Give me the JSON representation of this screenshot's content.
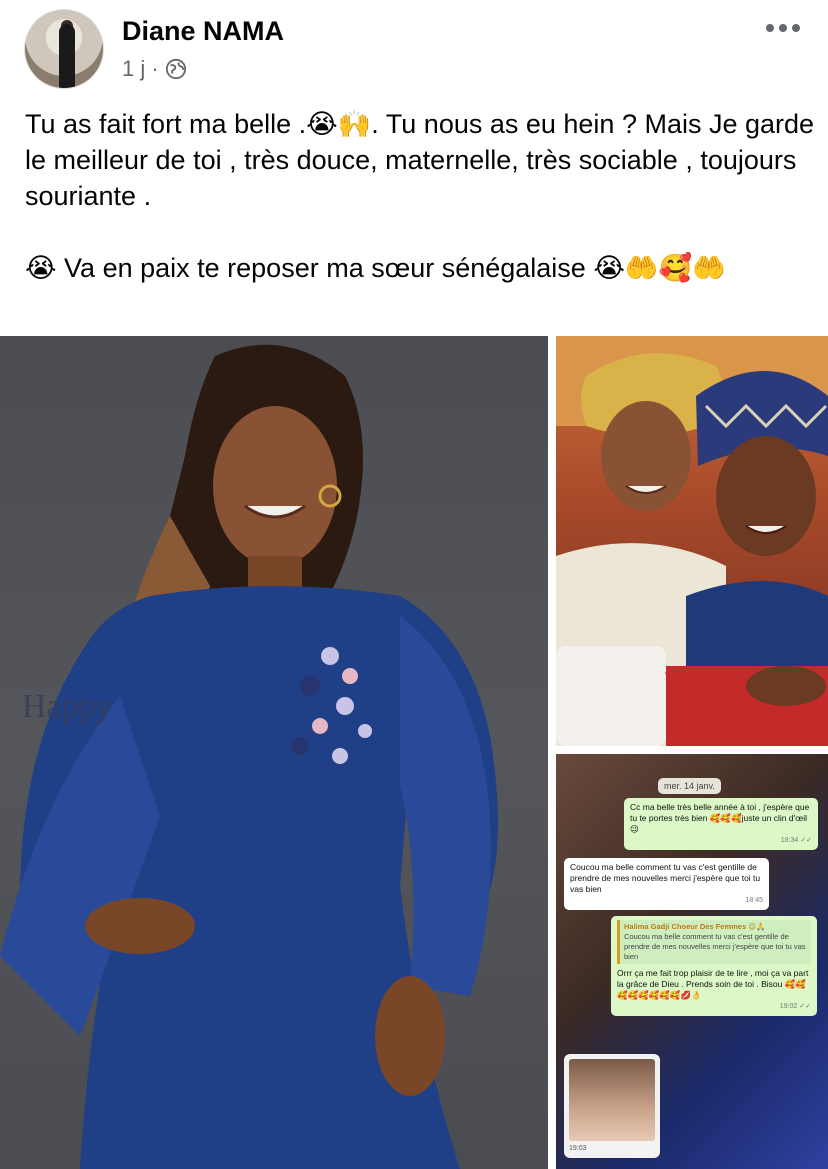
{
  "post": {
    "author": "Diane NAMA",
    "time": "1 j ·",
    "privacy_icon": "globe-icon",
    "text": "Tu as fait fort ma belle .😭🙌. Tu nous as eu hein ? Mais Je garde le meilleur de toi , très douce, maternelle, très sociable , toujours souriante .\n\n😭 Va en paix te reposer ma sœur sénégalaise 😭🤲🥰🤲"
  },
  "photos": {
    "main_watermark": "Happy",
    "chat": {
      "date": "mer. 14 janv.",
      "msg1": {
        "text": "Cc ma belle très belle année à toi , j'espère que tu te portes très bien 🥰🥰🥰juste un clin d'œil 😉",
        "time": "18:34 ✓✓"
      },
      "msg2": {
        "text": "Coucou ma belle comment tu vas c'est gentille de prendre de mes nouvelles merci j'espère que toi tu vas bien",
        "time": "18:45"
      },
      "msg3": {
        "quote_author": "Halima Gadji Choeur Des Femmes 😉🙏",
        "quote_text": "Coucou ma belle comment tu vas c'est gentille de prendre de mes nouvelles merci j'espère que toi tu vas bien",
        "text": "Orrr ça me fait trop plaisir de te lire , moi ça va part la grâce de Dieu . Prends soin de toi . Bisou 🥰🥰🥰🥰🥰🥰🥰🥰💋👌",
        "time": "19:02 ✓✓"
      },
      "thumb_time": "19:03"
    }
  }
}
